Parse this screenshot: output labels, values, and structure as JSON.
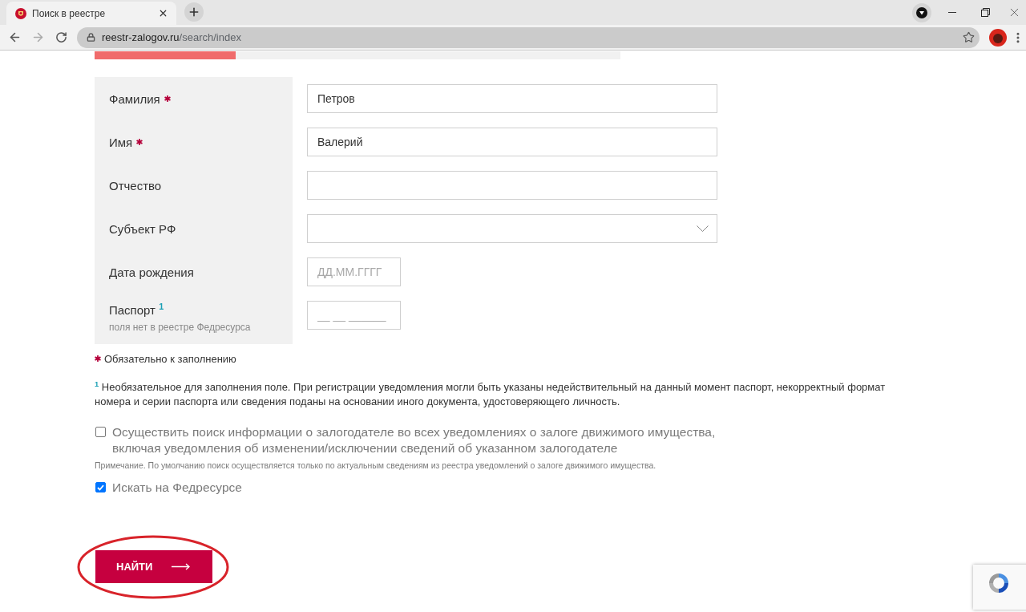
{
  "browser": {
    "tab": {
      "title": "Поиск в реестре"
    },
    "address_bar": {
      "host": "reestr-zalogov.ru",
      "path": "/search/index"
    }
  },
  "form": {
    "fields": [
      {
        "kind": "text",
        "label": "Фамилия",
        "required": true,
        "value": "Петров"
      },
      {
        "kind": "text",
        "label": "Имя",
        "required": true,
        "value": "Валерий"
      },
      {
        "kind": "text",
        "label": "Отчество",
        "required": false
      },
      {
        "kind": "select",
        "label": "Субъект РФ",
        "required": false
      },
      {
        "kind": "short",
        "label": "Дата рождения",
        "required": false,
        "placeholder": "ДД.ММ.ГГГГ"
      },
      {
        "kind": "short",
        "label": "Паспорт $^{1}$",
        "required": false,
        "hint": "поля нет в реестре Федресурса",
        "placeholder": "__ __ ______"
      }
    ],
    "required_note": "Обязательно к заполнению",
    "footnote": "$^{1}$ Необязательное для заполнения поле. При регистрации уведомления могли быть указаны недействительный на данный момент паспорт, некорректный формат номера и серии паспорта или сведения поданы на основании иного документа, удостоверяющего личность.",
    "options": [
      {
        "label": "Осуществить поиск информации о залогодателе во всех уведомлениях о залоге движимого имущества, включая уведомления об изменении/исключении сведений об указанном залогодателе",
        "checked": false,
        "note": "Примечание. По умолчанию поиск осуществляется только по актуальным сведениям из реестра уведомлений о залоге движимого имущества."
      },
      {
        "label": "Искать на Федресурсе",
        "checked": true
      }
    ],
    "submit_button": {
      "label": "НАЙТИ"
    }
  }
}
